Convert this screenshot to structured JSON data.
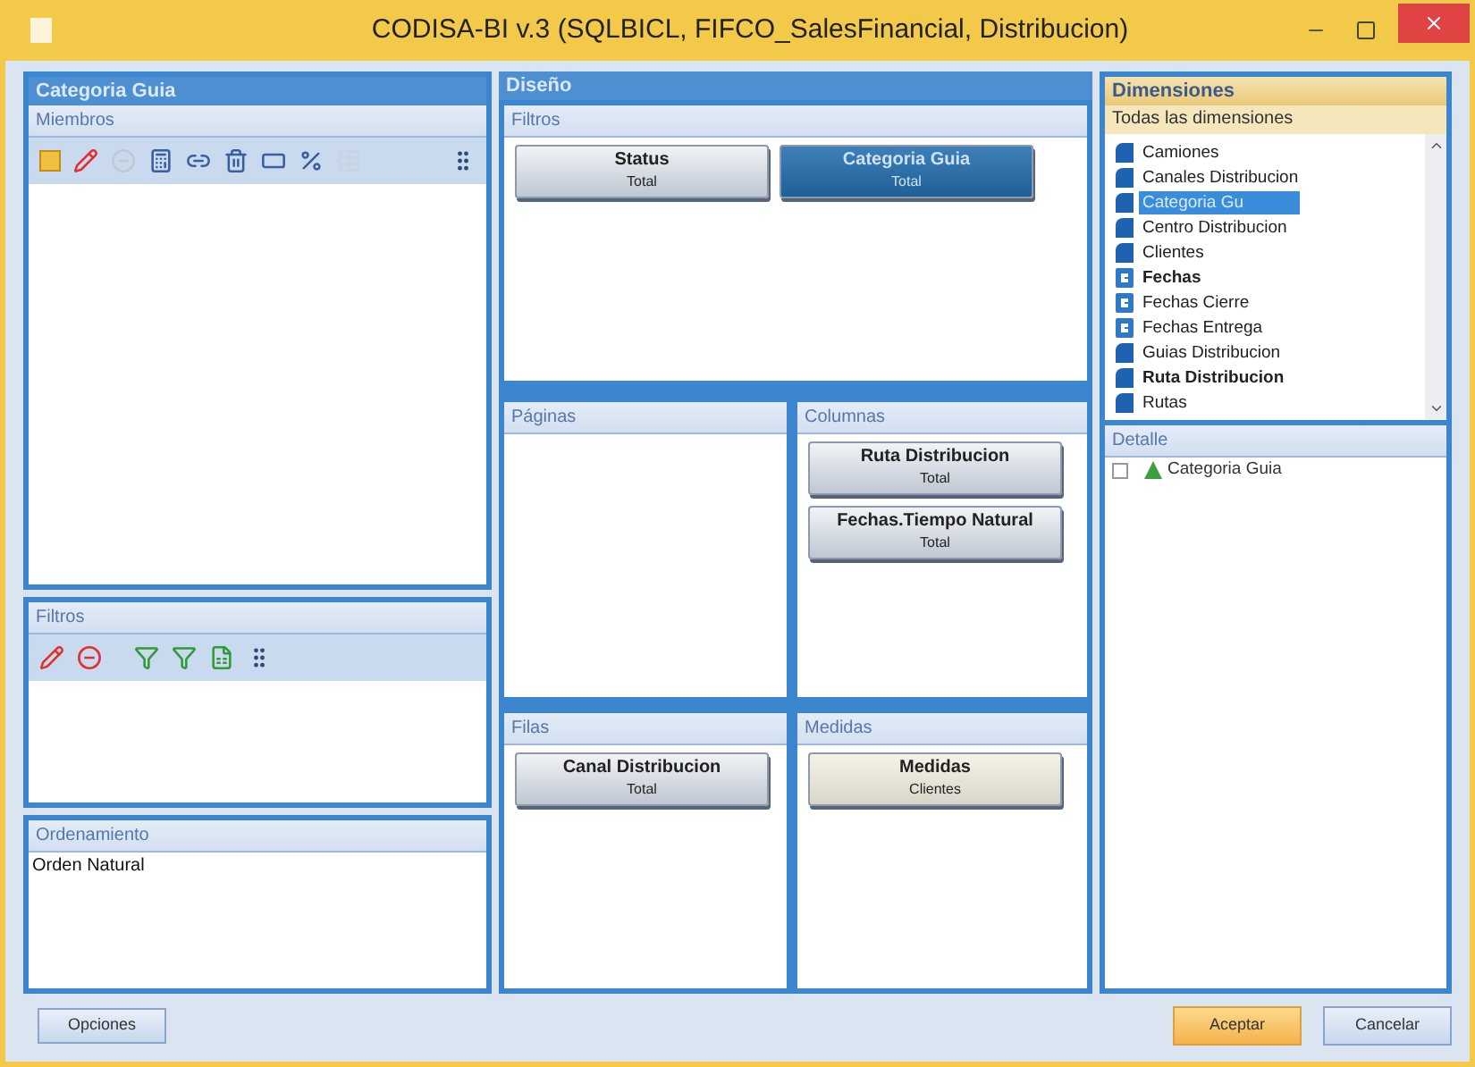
{
  "window": {
    "title": "CODISA-BI v.3 (SQLBICL, FIFCO_SalesFinancial, Distribucion)"
  },
  "left_panel": {
    "title": "Categoria Guia",
    "members": {
      "title": "Miembros"
    },
    "filters": {
      "title": "Filtros"
    },
    "sorting": {
      "title": "Ordenamiento",
      "value": "Orden Natural"
    }
  },
  "design": {
    "title": "Diseño",
    "filters": {
      "title": "Filtros",
      "fields": [
        {
          "name": "Status",
          "subtitle": "Total",
          "selected": false,
          "kind": "dimension"
        },
        {
          "name": "Categoria Guia",
          "subtitle": "Total",
          "selected": true,
          "kind": "dimension"
        }
      ]
    },
    "pages": {
      "title": "Páginas"
    },
    "columns": {
      "title": "Columnas",
      "fields": [
        {
          "name": "Ruta Distribucion",
          "subtitle": "Total",
          "selected": false,
          "kind": "dimension"
        },
        {
          "name": "Fechas.Tiempo Natural",
          "subtitle": "Total",
          "selected": false,
          "kind": "dimension"
        }
      ]
    },
    "rows": {
      "title": "Filas",
      "fields": [
        {
          "name": "Canal Distribucion",
          "subtitle": "Total",
          "selected": false,
          "kind": "dimension"
        }
      ]
    },
    "measures": {
      "title": "Medidas",
      "fields": [
        {
          "name": "Medidas",
          "subtitle": "Clientes",
          "selected": false,
          "kind": "measure"
        }
      ]
    }
  },
  "dimensions": {
    "title": "Dimensiones",
    "subtitle": "Todas las dimensiones",
    "items": [
      {
        "label": "Camiones",
        "kind": "cube",
        "in_use": false,
        "selected": false
      },
      {
        "label": "Canales Distribucion",
        "kind": "cube",
        "in_use": false,
        "selected": false
      },
      {
        "label": "Categoria Gu",
        "kind": "cube",
        "in_use": false,
        "selected": true
      },
      {
        "label": "Centro Distribucion",
        "kind": "cube",
        "in_use": false,
        "selected": false
      },
      {
        "label": "Clientes",
        "kind": "cube",
        "in_use": false,
        "selected": false
      },
      {
        "label": "Fechas",
        "kind": "date",
        "in_use": true,
        "selected": false
      },
      {
        "label": "Fechas Cierre",
        "kind": "date",
        "in_use": false,
        "selected": false
      },
      {
        "label": "Fechas Entrega",
        "kind": "date",
        "in_use": false,
        "selected": false
      },
      {
        "label": "Guias Distribucion",
        "kind": "cube",
        "in_use": false,
        "selected": false
      },
      {
        "label": "Ruta Distribucion",
        "kind": "cube",
        "in_use": true,
        "selected": false
      },
      {
        "label": "Rutas",
        "kind": "cube",
        "in_use": false,
        "selected": false
      }
    ]
  },
  "detail": {
    "title": "Detalle",
    "items": [
      {
        "label": "Categoria Guia",
        "expanded": false
      }
    ]
  },
  "buttons": {
    "options": "Opciones",
    "accept": "Aceptar",
    "cancel": "Cancelar"
  }
}
